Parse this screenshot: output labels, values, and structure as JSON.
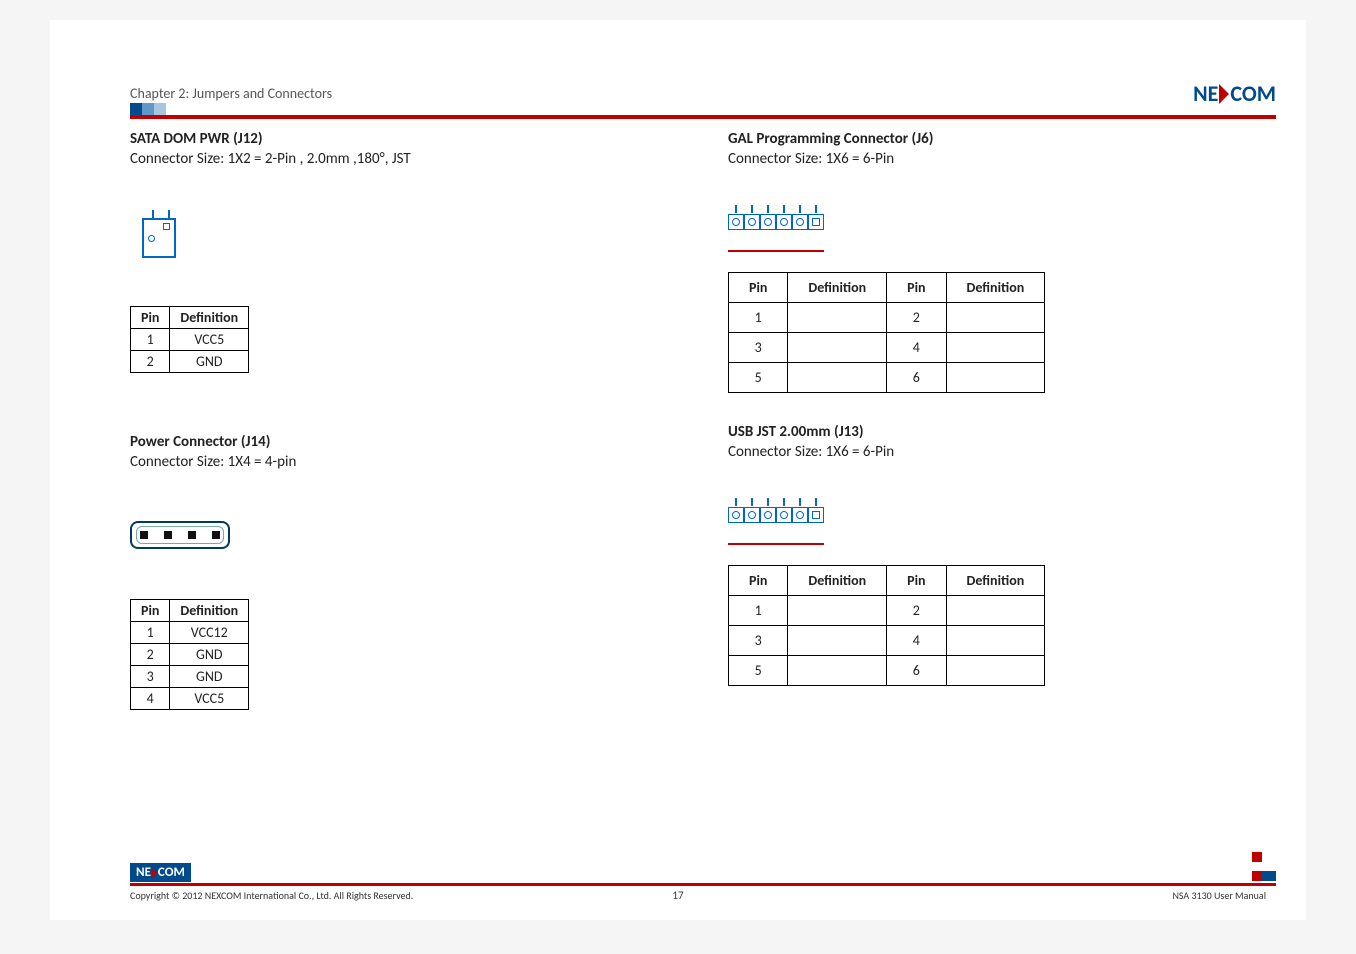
{
  "header": {
    "chapter": "Chapter 2: Jumpers and Connectors",
    "logo_ne": "NE",
    "logo_com": "COM"
  },
  "left": {
    "s1_title": "SATA DOM PWR (J12)",
    "s1_sub": "Connector Size: 1X2 = 2-Pin , 2.0mm ,180°, JST",
    "s1_table": {
      "headers": [
        "Pin",
        "Definition"
      ],
      "rows": [
        [
          "1",
          "VCC5"
        ],
        [
          "2",
          "GND"
        ]
      ]
    },
    "s2_title": "Power Connector (J14)",
    "s2_sub": "Connector Size: 1X4 = 4-pin",
    "s2_table": {
      "headers": [
        "Pin",
        "Definition"
      ],
      "rows": [
        [
          "1",
          "VCC12"
        ],
        [
          "2",
          "GND"
        ],
        [
          "3",
          "GND"
        ],
        [
          "4",
          "VCC5"
        ]
      ]
    }
  },
  "right": {
    "s1_title": "GAL Programming Connector (J6)",
    "s1_sub": "Connector Size: 1X6 = 6-Pin",
    "s1_table": {
      "headers": [
        "Pin",
        "Definition",
        "Pin",
        "Definition"
      ],
      "rows": [
        [
          "1",
          "",
          "2",
          ""
        ],
        [
          "3",
          "",
          "4",
          ""
        ],
        [
          "5",
          "",
          "6",
          ""
        ]
      ]
    },
    "s2_title": "USB JST 2.00mm (J13)",
    "s2_sub": "Connector Size: 1X6 = 6-Pin",
    "s2_table": {
      "headers": [
        "Pin",
        "Definition",
        "Pin",
        "Definition"
      ],
      "rows": [
        [
          "1",
          "",
          "2",
          ""
        ],
        [
          "3",
          "",
          "4",
          ""
        ],
        [
          "5",
          "",
          "6",
          ""
        ]
      ]
    }
  },
  "footer": {
    "logo_ne": "NE",
    "logo_com": "COM",
    "copyright": "Copyright © 2012 NEXCOM International Co., Ltd. All Rights Reserved.",
    "page": "17",
    "manual": "NSA 3130 User Manual"
  }
}
